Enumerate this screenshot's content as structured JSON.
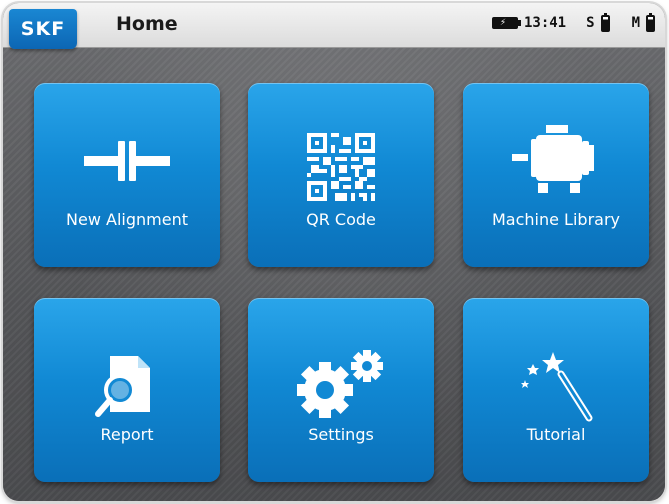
{
  "header": {
    "brand": "SKF",
    "title": "Home",
    "time": "13:41",
    "sensor_s": "S",
    "sensor_m": "M"
  },
  "tiles": [
    {
      "label": "New Alignment",
      "icon": "coupling-icon"
    },
    {
      "label": "QR Code",
      "icon": "qr-code-icon"
    },
    {
      "label": "Machine Library",
      "icon": "motor-icon"
    },
    {
      "label": "Report",
      "icon": "report-magnifier-icon"
    },
    {
      "label": "Settings",
      "icon": "gears-icon"
    },
    {
      "label": "Tutorial",
      "icon": "magic-wand-icon"
    }
  ],
  "colors": {
    "tile": "#1189d4",
    "brand": "#0c66b4",
    "background": "#5f6063"
  }
}
